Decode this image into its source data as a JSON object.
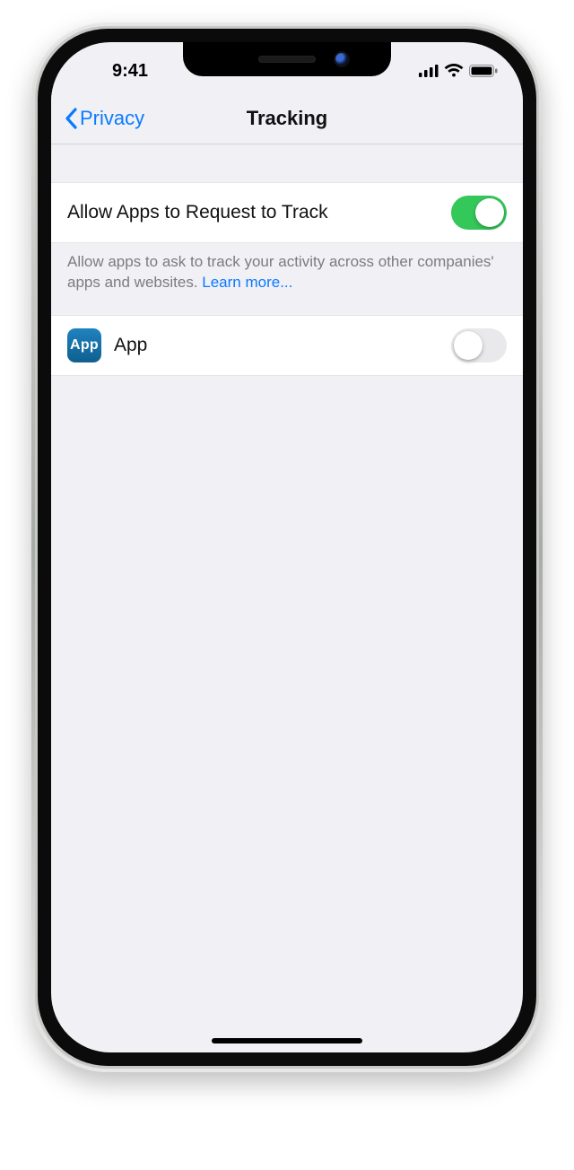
{
  "statusbar": {
    "time": "9:41"
  },
  "navbar": {
    "back_label": "Privacy",
    "title": "Tracking"
  },
  "settings": {
    "allow_request": {
      "label": "Allow Apps to Request to Track",
      "value": true,
      "footer_text": "Allow apps to ask to track your activity across other companies' apps and websites. ",
      "footer_link_label": "Learn more..."
    }
  },
  "apps": [
    {
      "icon_label": "App",
      "name": "App",
      "tracking_enabled": false
    }
  ]
}
